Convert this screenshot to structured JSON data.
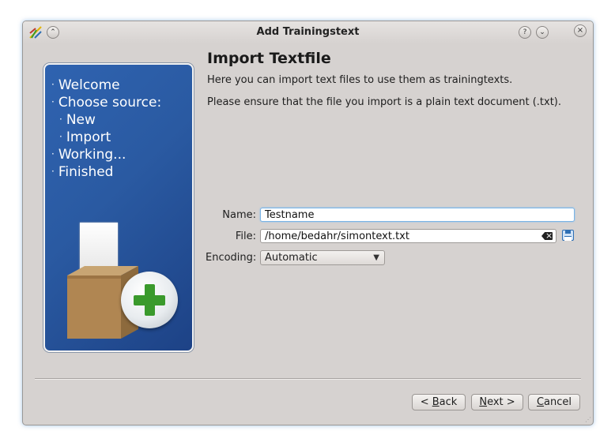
{
  "window": {
    "title": "Add Trainingstext",
    "help_button": "?",
    "shade_button": "⌄",
    "keep_above_button": "⌃",
    "close_button": "×"
  },
  "sidebar": {
    "steps": [
      {
        "label": "Welcome",
        "indent": 0
      },
      {
        "label": "Choose source:",
        "indent": 0
      },
      {
        "label": "New",
        "indent": 1
      },
      {
        "label": "Import",
        "indent": 1
      },
      {
        "label": "Working...",
        "indent": 0
      },
      {
        "label": "Finished",
        "indent": 0
      }
    ],
    "bullet": "·"
  },
  "main": {
    "heading": "Import Textfile",
    "description_1": "Here you can import text files to use them as trainingtexts.",
    "description_2": "Please ensure that the file you import is a plain text document (.txt)."
  },
  "form": {
    "name_label": "Name:",
    "name_value": "Testname",
    "file_label": "File:",
    "file_value": "/home/bedahr/simontext.txt",
    "encoding_label": "Encoding:",
    "encoding_value": "Automatic"
  },
  "buttons": {
    "back_prefix": "< ",
    "back_mnemonic": "B",
    "back_rest": "ack",
    "next_mnemonic": "N",
    "next_rest": "ext >",
    "cancel_mnemonic": "C",
    "cancel_rest": "ancel"
  },
  "colors": {
    "sidebar_blue": "#2a5aa2",
    "plus_green": "#3a9a2c",
    "window_bg": "#d6d2d0"
  },
  "icons": [
    "app-icon",
    "keep-above-icon",
    "help-icon",
    "shade-icon",
    "close-icon",
    "clear-icon",
    "save-icon",
    "chevron-down-icon",
    "box-add-icon"
  ]
}
